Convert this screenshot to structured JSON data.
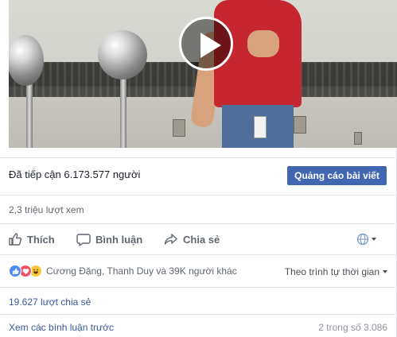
{
  "video": {
    "play_icon": "play-icon"
  },
  "stats": {
    "reach_text": "Đã tiếp cận 6.173.577 người",
    "promote_label": "Quảng cáo bài viết",
    "views_text": "2,3 triệu lượt xem"
  },
  "actions": {
    "like_label": "Thích",
    "comment_label": "Bình luận",
    "share_label": "Chia sẻ",
    "audience_icon": "globe-icon"
  },
  "reactions": {
    "types": [
      "like",
      "love",
      "haha"
    ],
    "names_text": "Cương Đặng, Thanh Duy và 39K người khác"
  },
  "sort": {
    "label": "Theo trình tự thời gian"
  },
  "shares_text": "19.627 lượt chia sẻ",
  "comments": {
    "view_previous_label": "Xem các bình luận trước",
    "count_text": "2 trong số 3.086"
  },
  "colors": {
    "accent": "#4267b2",
    "link": "#385898",
    "muted": "#606770"
  }
}
